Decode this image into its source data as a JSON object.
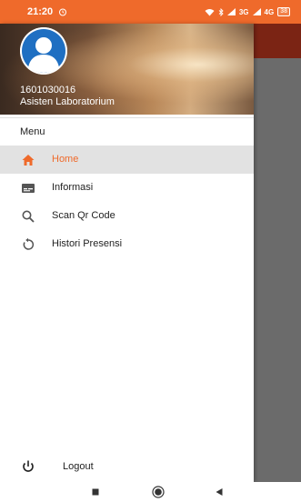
{
  "status_bar": {
    "time": "21:20",
    "icons_text": "3G",
    "icons_text2": "4G",
    "battery": "38",
    "color": "#ef6a2b"
  },
  "drawer": {
    "user_id": "1601030016",
    "user_role": "Asisten Laboratorium",
    "menu_title": "Menu",
    "items": [
      {
        "label": "Home",
        "icon": "home-icon",
        "active": true
      },
      {
        "label": "Informasi",
        "icon": "card-icon",
        "active": false
      },
      {
        "label": "Scan Qr Code",
        "icon": "search-icon",
        "active": false
      },
      {
        "label": "Histori Presensi",
        "icon": "history-icon",
        "active": false
      }
    ],
    "logout_label": "Logout",
    "accent_color": "#ef6a2b"
  },
  "system_nav": {
    "buttons": [
      "recents-icon",
      "home-circle-icon",
      "back-icon"
    ]
  }
}
